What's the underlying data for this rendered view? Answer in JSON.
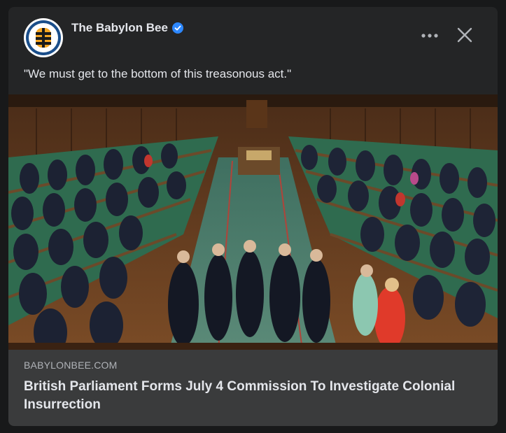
{
  "post": {
    "page_name": "The Babylon Bee",
    "caption": "\"We must get to the bottom of this treasonous act.\""
  },
  "link_preview": {
    "domain": "BABYLONBEE.COM",
    "headline": "British Parliament Forms July 4 Commission To Investigate Colonial Insurrection"
  },
  "colors": {
    "background": "#18191a",
    "card": "#242526",
    "link_preview_bg": "#3a3b3c",
    "verified_badge": "#2d88ff",
    "text_primary": "#e4e6eb",
    "text_secondary": "#b0b3b8",
    "bench_green": "#2f6b4f",
    "wood_panel": "#7a4b26"
  },
  "icons": {
    "avatar": "babylon-bee-logo",
    "verified": "verified-badge-icon",
    "more": "more-options-icon",
    "close": "close-icon"
  }
}
